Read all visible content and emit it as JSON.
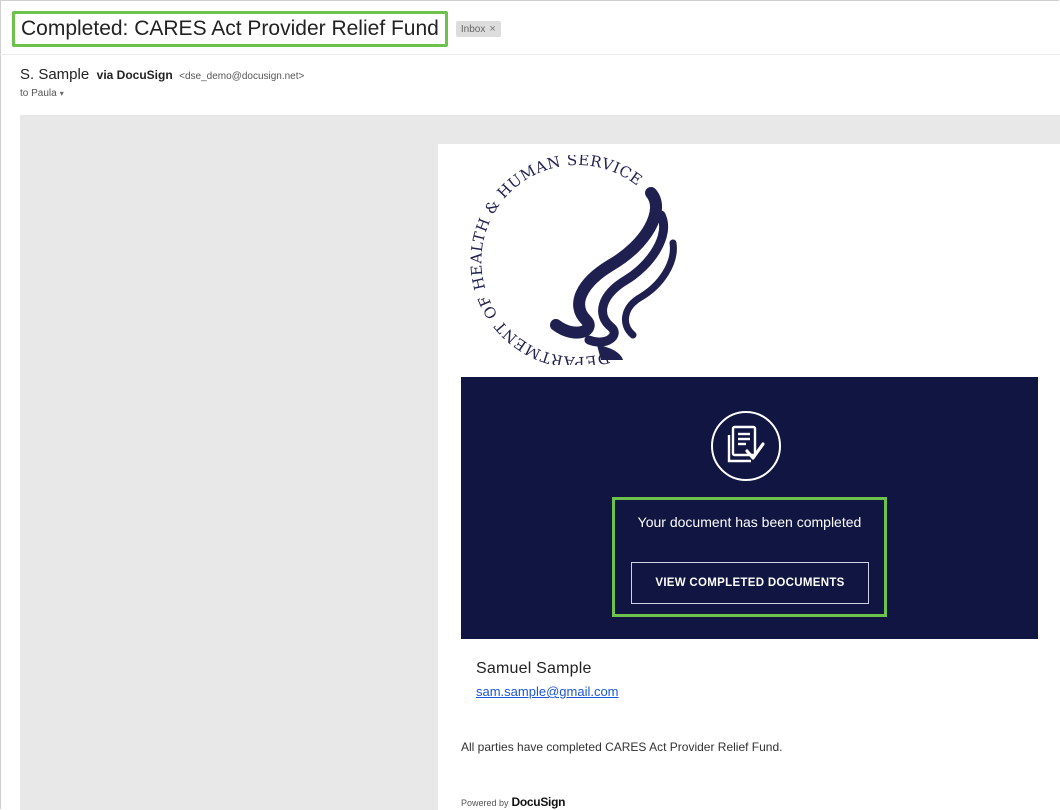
{
  "email": {
    "subject": "Completed: CARES Act Provider Relief Fund",
    "label": "Inbox",
    "label_close": "×",
    "sender": {
      "name": "S. Sample",
      "via": "via DocuSign",
      "address": "<dse_demo@docusign.net>"
    },
    "to_line": "to Paula",
    "to_caret": "▾"
  },
  "logo": {
    "alt": "Department of Health & Human Services USA seal",
    "color": "#1f2050"
  },
  "banner": {
    "background": "#101541",
    "icon": "document-check-icon",
    "message": "Your document has been completed",
    "button_label": "VIEW COMPLETED DOCUMENTS",
    "highlight_color": "#6cc24a"
  },
  "signature": {
    "name": "Samuel Sample",
    "email": "sam.sample@gmail.com"
  },
  "footer": {
    "completed_text": "All parties have completed CARES Act Provider Relief Fund.",
    "powered_by": "Powered by",
    "brand": "DocuSign"
  }
}
